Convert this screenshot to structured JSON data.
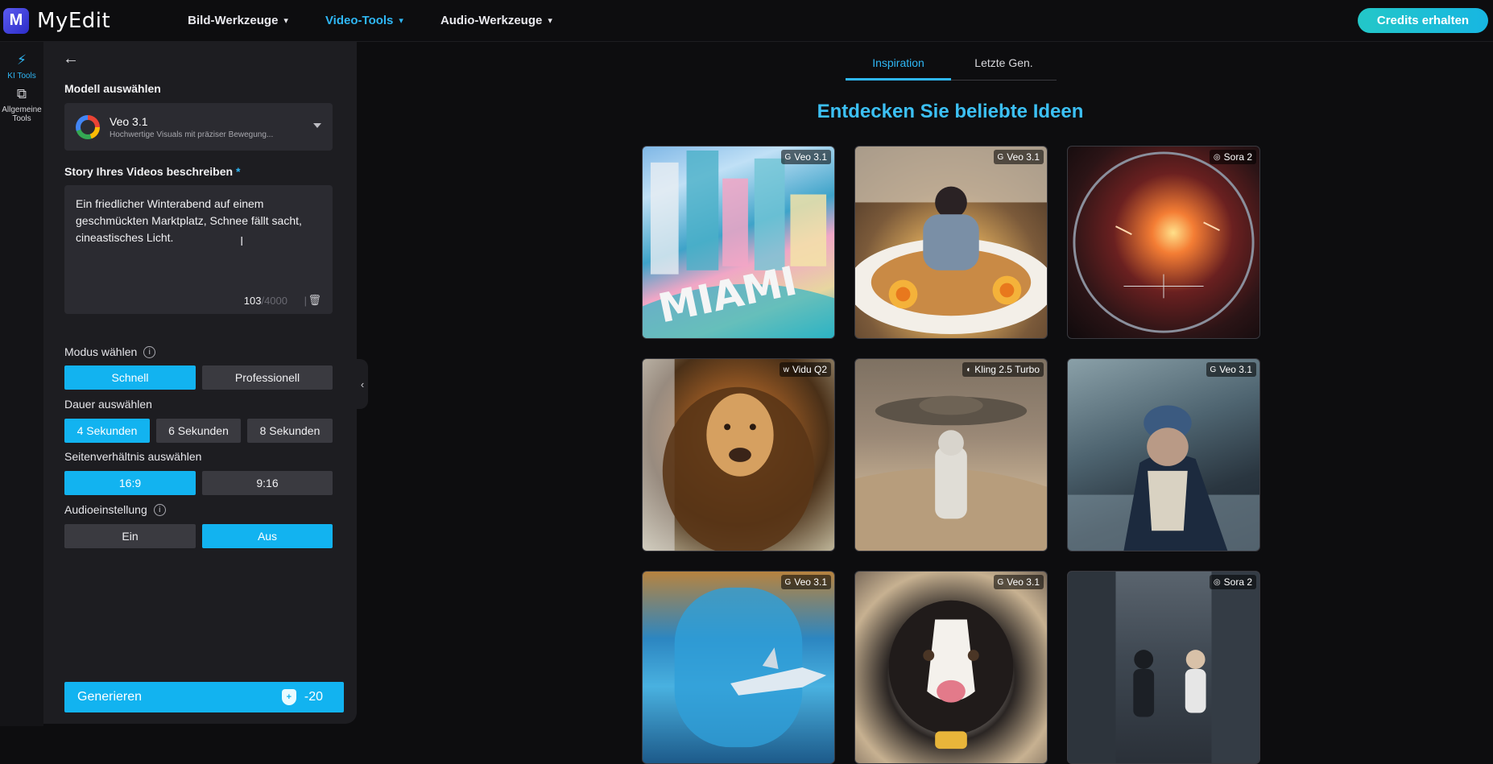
{
  "app": {
    "logo_letter": "M",
    "name": "MyEdit"
  },
  "nav": {
    "items": [
      {
        "label": "Bild-Werkzeuge"
      },
      {
        "label": "Video-Tools"
      },
      {
        "label": "Audio-Werkzeuge"
      }
    ],
    "credits_label": "Credits erhalten"
  },
  "rail": {
    "items": [
      {
        "label": "KI Tools",
        "icon": "magic-wand-icon"
      },
      {
        "label": "Allgemeine Tools",
        "icon": "layers-icon"
      }
    ]
  },
  "panel": {
    "model_label": "Modell auswählen",
    "model_name": "Veo 3.1",
    "model_desc": "Hochwertige Visuals mit präziser Bewegung...",
    "story_label": "Story Ihres Videos beschreiben",
    "required_mark": "*",
    "story_text": "Ein friedlicher Winterabend auf einem geschmückten Marktplatz, Schnee fällt sacht, cineastisches Licht.",
    "char_count": "103",
    "char_max": "/4000",
    "separator": "|",
    "mode_label": "Modus wählen",
    "mode_options": [
      "Schnell",
      "Professionell"
    ],
    "duration_label": "Dauer auswählen",
    "duration_options": [
      "4 Sekunden",
      "6 Sekunden",
      "8 Sekunden"
    ],
    "ratio_label": "Seitenverhältnis auswählen",
    "ratio_options": [
      "16:9",
      "9:16"
    ],
    "audio_label": "Audioeinstellung",
    "audio_options": [
      "Ein",
      "Aus"
    ],
    "generate_label": "Generieren",
    "generate_cost": "-20"
  },
  "main": {
    "tabs": [
      "Inspiration",
      "Letzte Gen."
    ],
    "headline": "Entdecken Sie beliebte Ideen",
    "cards": [
      {
        "model": "Veo 3.1",
        "overlay_text": "MIAMI"
      },
      {
        "model": "Veo 3.1"
      },
      {
        "model": "Sora 2"
      },
      {
        "model": "Vidu Q2"
      },
      {
        "model": "Kling 2.5 Turbo"
      },
      {
        "model": "Veo 3.1"
      },
      {
        "model": "Veo 3.1"
      },
      {
        "model": "Veo 3.1"
      },
      {
        "model": "Sora 2"
      }
    ]
  },
  "colors": {
    "accent": "#12b3f0",
    "credits_gradient_start": "#23c7c8",
    "panel_bg": "#1d1d21",
    "page_bg": "#0d0d0f"
  }
}
